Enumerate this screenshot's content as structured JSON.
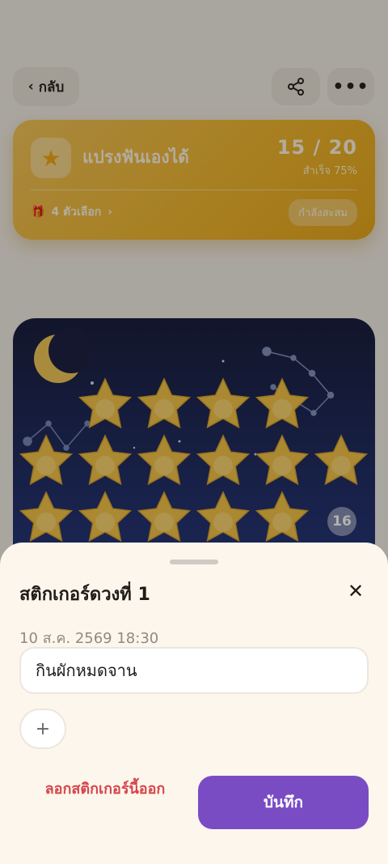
{
  "header": {
    "back_label": "กลับ",
    "back_icon": "‹",
    "more_icon": "•••"
  },
  "goal": {
    "icon": "★",
    "title": "แปรงฟันเองได้",
    "count": "15 / 20",
    "success": "สำเร็จ 75%",
    "reward_icon": "🎁",
    "reward_text": "4 ตัวเลือก",
    "reward_chevron": "›",
    "status": "กำลังสะสม",
    "accent": "#f1b730"
  },
  "board": {
    "current_sticker_number": "16",
    "sky_color": "#1b1f3d"
  },
  "sheet": {
    "title": "สติกเกอร์ดวงที่ 1",
    "close_icon": "✕",
    "date": "10 ส.ค. 2569 18:30",
    "note_value": "กินผักหมดจาน",
    "add_icon": "+",
    "remove_label": "ลอกสติกเกอร์นี้ออก",
    "save_label": "บันทึก",
    "save_color": "#7a4cc4",
    "remove_color": "#d6454d"
  }
}
